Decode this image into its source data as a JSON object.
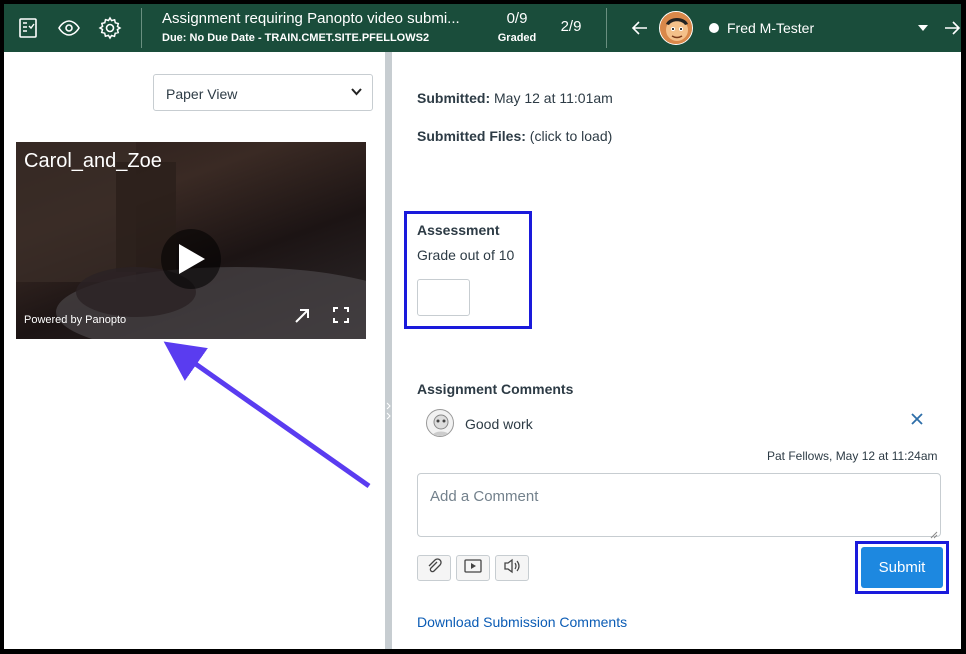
{
  "header": {
    "title": "Assignment requiring Panopto video submi...",
    "due": "Due: No Due Date - TRAIN.CMET.SITE.PFELLOWS2",
    "graded_count": "0/9",
    "graded_label": "Graded",
    "position": "2/9",
    "student_name": "Fred M-Tester",
    "colors": {
      "bar": "#1a4d3b"
    }
  },
  "left": {
    "view_select": "Paper View",
    "video": {
      "title": "Carol_and_Zoe",
      "powered_by": "Powered by Panopto"
    }
  },
  "right": {
    "submitted_label": "Submitted:",
    "submitted_value": "May 12 at 11:01am",
    "files_label": "Submitted Files:",
    "files_value": "(click to load)",
    "assessment_title": "Assessment",
    "grade_label": "Grade out of 10",
    "grade_value": "",
    "comments_title": "Assignment Comments",
    "comment": {
      "text": "Good work",
      "meta": "Pat Fellows, May 12 at 11:24am"
    },
    "comment_placeholder": "Add a Comment",
    "submit_label": "Submit",
    "download_label": "Download Submission Comments",
    "colors": {
      "link": "#0b5cb5",
      "submit": "#1d88e0",
      "highlight": "#1a1adb"
    }
  }
}
